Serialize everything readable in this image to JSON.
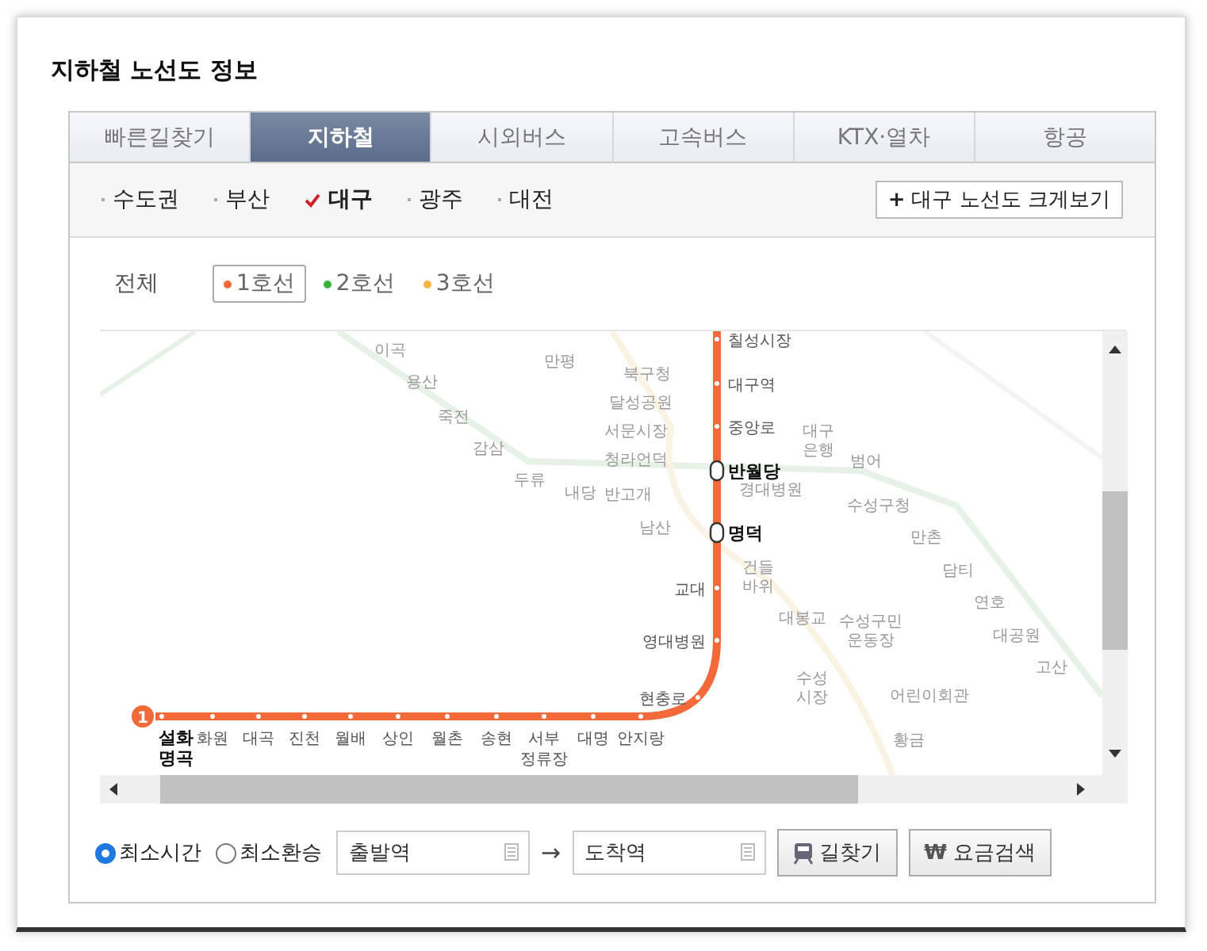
{
  "title": "지하철 노선도 정보",
  "tabs": [
    {
      "label": "빠른길찾기",
      "selected": false
    },
    {
      "label": "지하철",
      "selected": true
    },
    {
      "label": "시외버스",
      "selected": false
    },
    {
      "label": "고속버스",
      "selected": false
    },
    {
      "label": "KTX·열차",
      "selected": false
    },
    {
      "label": "항공",
      "selected": false
    }
  ],
  "regions": [
    {
      "label": "수도권",
      "selected": false
    },
    {
      "label": "부산",
      "selected": false
    },
    {
      "label": "대구",
      "selected": true
    },
    {
      "label": "광주",
      "selected": false
    },
    {
      "label": "대전",
      "selected": false
    }
  ],
  "enlarge_button": {
    "icon": "+",
    "label": "대구 노선도 크게보기"
  },
  "line_filter": {
    "all_label": "전체",
    "lines": [
      {
        "label": "1호선",
        "selected": true,
        "color": "#f26a3a"
      },
      {
        "label": "2호선",
        "selected": false,
        "color": "#3bb33b"
      },
      {
        "label": "3호선",
        "selected": false,
        "color": "#f5b340"
      }
    ]
  },
  "map": {
    "line_badge": "1",
    "stations": [
      {
        "name": "칠성시장",
        "transfer": false,
        "terminal": false
      },
      {
        "name": "대구역",
        "transfer": false,
        "terminal": false
      },
      {
        "name": "중앙로",
        "transfer": false,
        "terminal": false
      },
      {
        "name": "반월당",
        "transfer": true,
        "terminal": false
      },
      {
        "name": "명덕",
        "transfer": true,
        "terminal": false
      },
      {
        "name": "교대",
        "transfer": false,
        "terminal": false
      },
      {
        "name": "영대병원",
        "transfer": false,
        "terminal": false
      },
      {
        "name": "현충로",
        "transfer": false,
        "terminal": false
      },
      {
        "name": "설화\n명곡",
        "transfer": false,
        "terminal": true
      },
      {
        "name": "화원",
        "transfer": false,
        "terminal": false
      },
      {
        "name": "대곡",
        "transfer": false,
        "terminal": false
      },
      {
        "name": "진천",
        "transfer": false,
        "terminal": false
      },
      {
        "name": "월배",
        "transfer": false,
        "terminal": false
      },
      {
        "name": "상인",
        "transfer": false,
        "terminal": false
      },
      {
        "name": "월촌",
        "transfer": false,
        "terminal": false
      },
      {
        "name": "송현",
        "transfer": false,
        "terminal": false
      },
      {
        "name": "서부\n정류장",
        "transfer": false,
        "terminal": false
      },
      {
        "name": "대명",
        "transfer": false,
        "terminal": false
      },
      {
        "name": "안지랑",
        "transfer": false,
        "terminal": false
      }
    ],
    "other_stations": [
      "이곡",
      "용산",
      "죽전",
      "감삼",
      "두류",
      "내당",
      "만평",
      "북구청",
      "달성공원",
      "서문시장",
      "청라언덕",
      "반고개",
      "남산",
      "대구\n은행",
      "범어",
      "경대병원",
      "수성구청",
      "만촌",
      "담티",
      "연호",
      "대공원",
      "고산",
      "건들\n바위",
      "대봉교",
      "수성구민\n운동장",
      "수성\n시장",
      "어린이회관",
      "황금"
    ]
  },
  "route_search": {
    "options": [
      {
        "label": "최소시간",
        "selected": true
      },
      {
        "label": "최소환승",
        "selected": false
      }
    ],
    "from": {
      "placeholder": "출발역"
    },
    "arrow": "→",
    "to": {
      "placeholder": "도착역"
    },
    "buttons": [
      {
        "kind": "route",
        "label": "길찾기"
      },
      {
        "kind": "fare",
        "label": "요금검색",
        "icon": "₩"
      }
    ]
  }
}
